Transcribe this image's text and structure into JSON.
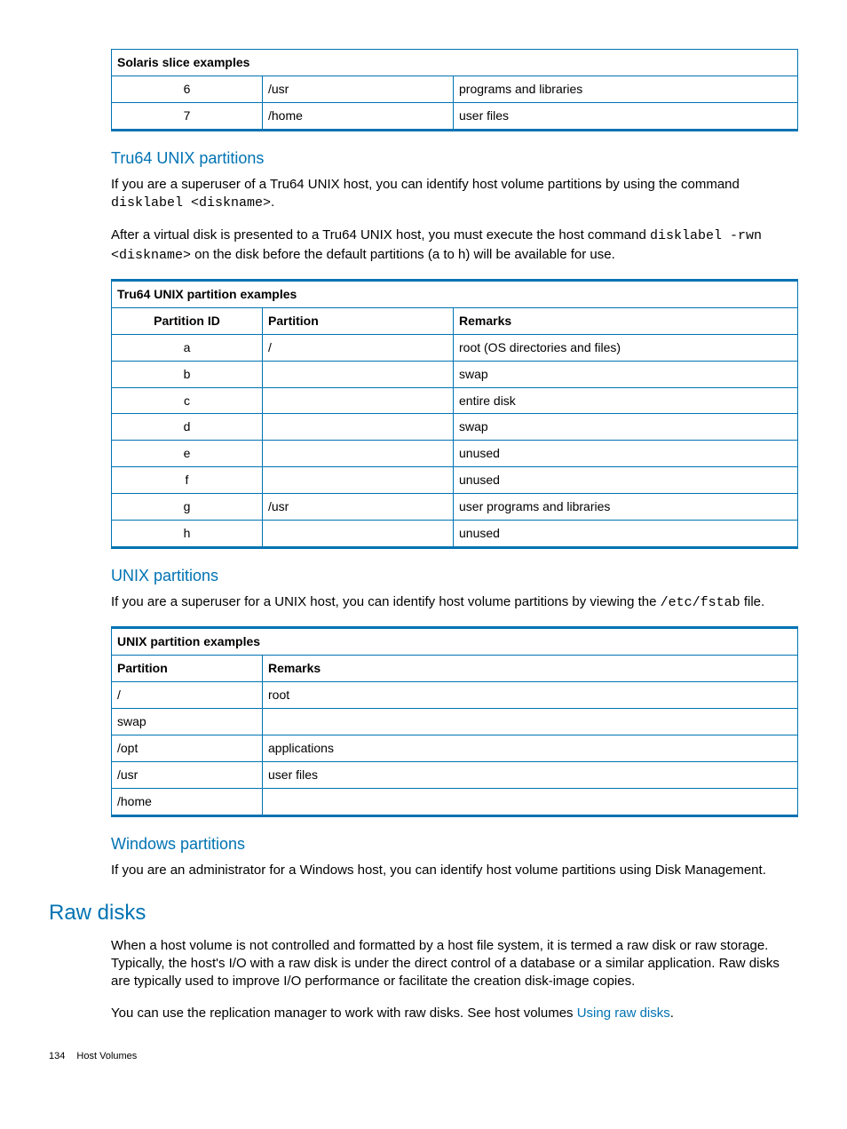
{
  "solaris": {
    "title": "Solaris slice examples",
    "rows": [
      {
        "id": "6",
        "partition": "/usr",
        "remarks": "programs and libraries"
      },
      {
        "id": "7",
        "partition": "/home",
        "remarks": "user files"
      }
    ]
  },
  "tru64": {
    "heading": "Tru64 UNIX partitions",
    "para1a": "If you are a superuser of a Tru64 UNIX host, you can identify host volume partitions by using the command ",
    "code1": "disklabel <diskname>",
    "para1b": ".",
    "para2a": "After a virtual disk is presented to a Tru64 UNIX host, you must execute the host command ",
    "code2": "disklabel -rwn <diskname>",
    "para2b": " on the disk before the default partitions (a to h) will be available for use.",
    "table_title": "Tru64 UNIX partition examples",
    "columns": {
      "c1": "Partition ID",
      "c2": "Partition",
      "c3": "Remarks"
    },
    "rows": [
      {
        "id": "a",
        "partition": "/",
        "remarks": "root (OS directories and files)"
      },
      {
        "id": "b",
        "partition": "",
        "remarks": "swap"
      },
      {
        "id": "c",
        "partition": "",
        "remarks": "entire disk"
      },
      {
        "id": "d",
        "partition": "",
        "remarks": "swap"
      },
      {
        "id": "e",
        "partition": "",
        "remarks": "unused"
      },
      {
        "id": "f",
        "partition": "",
        "remarks": "unused"
      },
      {
        "id": "g",
        "partition": "/usr",
        "remarks": "user programs and libraries"
      },
      {
        "id": "h",
        "partition": "",
        "remarks": "unused"
      }
    ]
  },
  "unix": {
    "heading": "UNIX partitions",
    "para_a": "If you are a superuser for a UNIX host, you can identify host volume partitions by viewing the ",
    "code": "/etc/fstab",
    "para_b": " file.",
    "table_title": "UNIX partition examples",
    "columns": {
      "c1": "Partition",
      "c2": "Remarks"
    },
    "rows": [
      {
        "partition": "/",
        "remarks": "root"
      },
      {
        "partition": "swap",
        "remarks": ""
      },
      {
        "partition": "/opt",
        "remarks": "applications"
      },
      {
        "partition": "/usr",
        "remarks": "user files"
      },
      {
        "partition": "/home",
        "remarks": ""
      }
    ]
  },
  "windows": {
    "heading": "Windows partitions",
    "para": "If you are an administrator for a Windows host, you can identify host volume partitions using Disk Management."
  },
  "rawdisks": {
    "heading": "Raw disks",
    "para1": "When a host volume is not controlled and formatted by a host file system, it is termed a raw disk or raw storage. Typically, the host's I/O with a raw disk is under the direct control of a database or a similar application. Raw disks are typically used to improve I/O performance or facilitate the creation disk-image copies.",
    "para2a": "You can use the replication manager to work with raw disks. See host volumes ",
    "link": "Using raw disks",
    "para2b": "."
  },
  "footer": {
    "page": "134",
    "section": "Host Volumes"
  }
}
